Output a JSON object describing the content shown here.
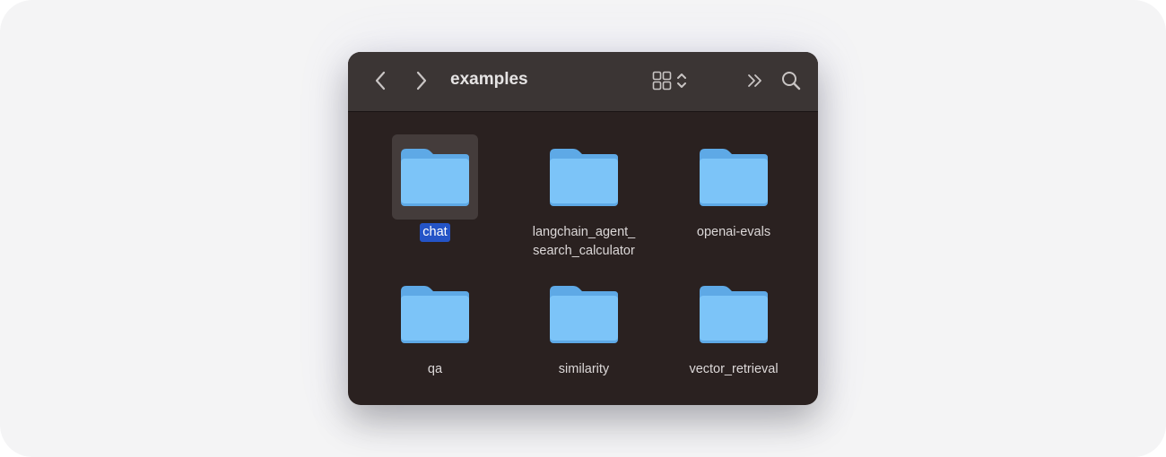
{
  "window": {
    "title": "examples",
    "toolbar": {
      "back_icon": "chevron-left-icon",
      "forward_icon": "chevron-right-icon",
      "view_icon": "grid-view-icon",
      "view_toggle_icon": "up-down-chevron-icon",
      "more_icon": "double-chevron-right-icon",
      "search_icon": "magnifier-icon"
    }
  },
  "colors": {
    "folder": "#7cc4f8",
    "folder_tab": "#5ea9e6",
    "selection": "#2454c7"
  },
  "items": [
    {
      "name": "chat",
      "selected": true
    },
    {
      "name": "langchain_agent_\nsearch_calculator",
      "line1": "langchain_agent_",
      "line2": "search_calculator",
      "selected": false
    },
    {
      "name": "openai-evals",
      "selected": false
    },
    {
      "name": "qa",
      "selected": false
    },
    {
      "name": "similarity",
      "selected": false
    },
    {
      "name": "vector_retrieval",
      "selected": false
    }
  ]
}
